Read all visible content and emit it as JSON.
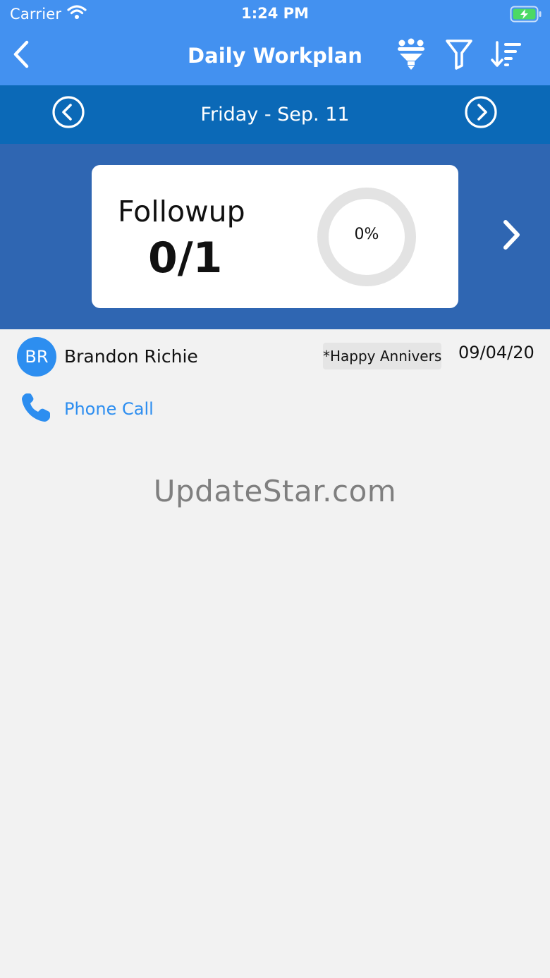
{
  "status_bar": {
    "carrier": "Carrier",
    "time": "1:24 PM"
  },
  "nav": {
    "title": "Daily Workplan"
  },
  "date_bar": {
    "date": "Friday - Sep. 11"
  },
  "summary": {
    "title": "Followup",
    "count": "0/1",
    "percent": "0%",
    "progress_fraction": 0
  },
  "items": [
    {
      "initials": "BR",
      "name": "Brandon Richie",
      "note": "*Happy Anniversary",
      "date": "09/04/20",
      "action": "Phone Call"
    }
  ],
  "watermark": "UpdateStar.com",
  "colors": {
    "nav_bg": "#4391f0",
    "date_bar_bg": "#0b69b7",
    "summary_band_bg": "#2f66b2",
    "accent_blue": "#2d8ef0",
    "page_bg": "#f2f2f2",
    "progress_track": "#e3e3e3"
  },
  "icons": {
    "back": "chevron-left-icon",
    "group_filter": "people-funnel-icon",
    "filter": "funnel-icon",
    "sort": "sort-descending-icon",
    "prev_day": "circle-chevron-left-icon",
    "next_day": "circle-chevron-right-icon",
    "next_summary": "chevron-right-icon",
    "call": "phone-icon"
  }
}
